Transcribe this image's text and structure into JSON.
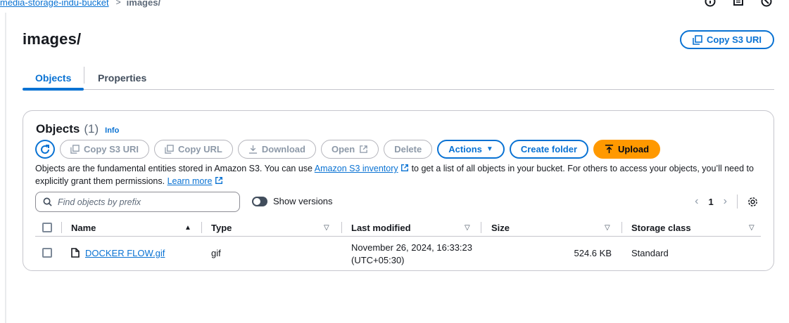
{
  "breadcrumb": {
    "bucket": "media-storage-indu-bucket",
    "current": "images/"
  },
  "page": {
    "title": "images/",
    "copy_s3_uri": "Copy S3 URI"
  },
  "tabs": [
    {
      "label": "Objects",
      "active": true
    },
    {
      "label": "Properties",
      "active": false
    }
  ],
  "objects_panel": {
    "title": "Objects",
    "count": "(1)",
    "info": "Info",
    "buttons": {
      "copy_s3_uri": "Copy S3 URI",
      "copy_url": "Copy URL",
      "download": "Download",
      "open": "Open",
      "delete": "Delete",
      "actions": "Actions",
      "create_folder": "Create folder",
      "upload": "Upload"
    },
    "description": {
      "part1": "Objects are the fundamental entities stored in Amazon S3. You can use ",
      "inventory_link": "Amazon S3 inventory",
      "part2": " to get a list of all objects in your bucket. For others to access your objects, you’ll need to explicitly grant them permissions. ",
      "learn_more": "Learn more"
    },
    "search_placeholder": "Find objects by prefix",
    "show_versions": "Show versions",
    "current_page": "1"
  },
  "table": {
    "columns": {
      "name": "Name",
      "type": "Type",
      "last_modified": "Last modified",
      "size": "Size",
      "storage_class": "Storage class"
    },
    "rows": [
      {
        "name": "DOCKER FLOW.gif",
        "type": "gif",
        "last_modified_1": "November 26, 2024, 16:33:23",
        "last_modified_2": "(UTC+05:30)",
        "size": "524.6 KB",
        "storage_class": "Standard"
      }
    ]
  },
  "colors": {
    "accent": "#0972d3",
    "upload": "#ff9900"
  }
}
